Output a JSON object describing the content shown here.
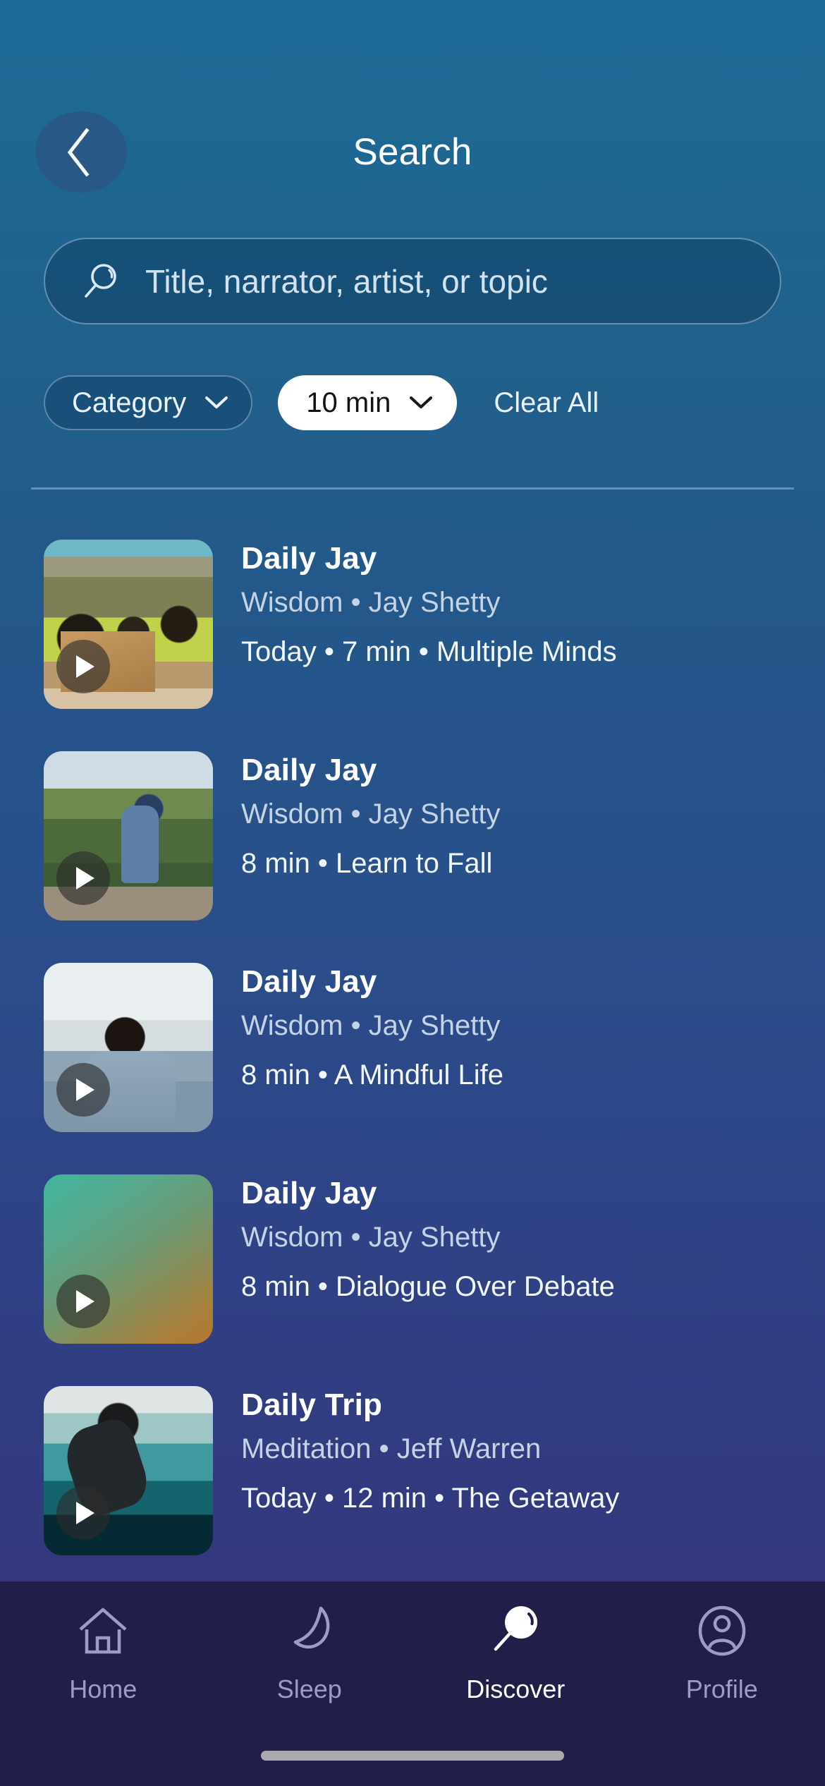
{
  "theme": {
    "gradient_top": "#1d6a96",
    "gradient_bottom": "#332f73",
    "nav_bar_bg": "#211f49",
    "accent_white": "#ffffff",
    "chip_active_bg": "#ffffff",
    "subtitle_color": "#c4d4e6"
  },
  "header": {
    "title": "Search",
    "back_icon": "chevron-left-icon"
  },
  "search": {
    "icon": "search-icon",
    "placeholder": "Title, narrator, artist, or topic",
    "value": ""
  },
  "filters": {
    "chips": [
      {
        "label": "Category",
        "selected": false,
        "caret_icon": "chevron-down-icon"
      },
      {
        "label": "10 min",
        "selected": true,
        "caret_icon": "chevron-down-icon"
      }
    ],
    "clear_all_label": "Clear All"
  },
  "results": [
    {
      "title": "Daily Jay",
      "subtitle": "Wisdom • Jay Shetty",
      "detail": "Today • 7 min • Multiple Minds",
      "art": "art-volunteers",
      "play_icon": "play-icon"
    },
    {
      "title": "Daily Jay",
      "subtitle": "Wisdom • Jay Shetty",
      "detail": "8 min • Learn to Fall",
      "art": "art-trampoline",
      "play_icon": "play-icon"
    },
    {
      "title": "Daily Jay",
      "subtitle": "Wisdom • Jay Shetty",
      "detail": "8 min • A Mindful Life",
      "art": "art-mindful",
      "play_icon": "play-icon"
    },
    {
      "title": "Daily Jay",
      "subtitle": "Wisdom • Jay Shetty",
      "detail": "8 min • Dialogue Over Debate",
      "art": "art-gradient",
      "play_icon": "play-icon"
    },
    {
      "title": "Daily Trip",
      "subtitle": "Meditation • Jeff Warren",
      "detail": "Today • 12 min • The Getaway",
      "art": "art-diver",
      "play_icon": "play-icon"
    }
  ],
  "peek_row": {
    "art": "art-red"
  },
  "bottom_nav": {
    "items": [
      {
        "label": "Home",
        "icon": "home-icon",
        "active": false
      },
      {
        "label": "Sleep",
        "icon": "moon-icon",
        "active": false
      },
      {
        "label": "Discover",
        "icon": "search-filled-icon",
        "active": true
      },
      {
        "label": "Profile",
        "icon": "user-circle-icon",
        "active": false
      }
    ]
  }
}
